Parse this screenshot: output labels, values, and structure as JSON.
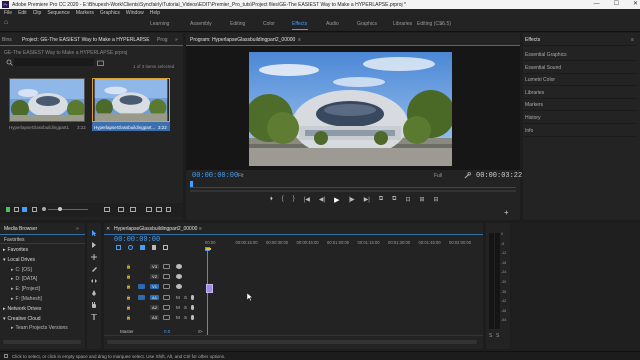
{
  "window": {
    "title": "Adobe Premiere Pro CC 2020 - E:\\Bhupesh-Work\\Clients\\Syncfairly\\Tutorial_Videos\\EDIT\\Premier_Pro_tuts\\Project files\\GE-The EASIEST Way to Make a HYPERLAPSE.prproj *",
    "app_icon": "Pr",
    "min": "—",
    "max": "☐",
    "close": "✕"
  },
  "menu": [
    "File",
    "Edit",
    "Clip",
    "Sequence",
    "Markers",
    "Graphics",
    "Window",
    "Help"
  ],
  "workspaces": {
    "home": "⌂",
    "tabs": [
      "Learning",
      "Assembly",
      "Editing",
      "Color",
      "Effects",
      "Audio",
      "Graphics",
      "Libraries",
      "Editing (CS5.5)"
    ],
    "active": "Effects",
    "more": "»"
  },
  "project_panel": {
    "tabs": [
      "Bins",
      "Project: GE-The EASIEST Way to Make a HYPERLAPSE",
      "Prog"
    ],
    "menu": "≡",
    "expand": "»",
    "path": "GE-The EASIEST Way to Make a HYPERLAPSE.prproj",
    "items_selected": "1 of 3 items selected",
    "clip1_name": "HyperlapseGlassbuildingpart1",
    "clip1_dur": "3:22",
    "clip2_name": "HyperlapseGlassbuildingpart...",
    "clip2_dur": "3:22"
  },
  "program_monitor": {
    "title": "Program: HyperlapseGlassbuildingpart2_00000",
    "menu": "≡",
    "timecode_left": "00:00:00:00",
    "fit": "Fit",
    "quality": "Full",
    "timecode_right": "00:00:03:22",
    "controls": [
      "⬧",
      "{",
      "}",
      "|◀",
      "◀|",
      "▶",
      "|▶",
      "▶|",
      "⧉",
      "⧉",
      "⊡",
      "⊞",
      "⊟"
    ],
    "add": "+"
  },
  "effects_panel": {
    "title": "Effects",
    "menu": "≡",
    "items": [
      "Essential Graphics",
      "Essential Sound",
      "Lumetri Color",
      "Libraries",
      "Markers",
      "History",
      "Info"
    ]
  },
  "media_browser": {
    "tabs": [
      "Media Browser"
    ],
    "expand": "»",
    "favorites_header": "Favorites",
    "items": [
      {
        "label": "Favorites",
        "indent": 0,
        "arrow": "▸"
      },
      {
        "label": "Local Drives",
        "indent": 0,
        "arrow": "▾"
      },
      {
        "label": "C: [OS]",
        "indent": 1,
        "arrow": "▸"
      },
      {
        "label": "D: [DATA]",
        "indent": 1,
        "arrow": "▸"
      },
      {
        "label": "E: [Project]",
        "indent": 1,
        "arrow": "▸"
      },
      {
        "label": "F: [Mahesh]",
        "indent": 1,
        "arrow": "▸"
      },
      {
        "label": "Network Drives",
        "indent": 0,
        "arrow": "▸"
      },
      {
        "label": "Creative Cloud",
        "indent": 0,
        "arrow": "▾"
      },
      {
        "label": "Team Projects Versions",
        "indent": 1,
        "arrow": "▸"
      }
    ]
  },
  "timeline": {
    "title": "HyperlapseGlassbuildingpart2_00000",
    "menu": "≡",
    "timecode": "00:00:00:00",
    "ruler": [
      "00:00",
      "00:00:15:00",
      "00:00:30:00",
      "00:00:45:00",
      "00:01:00:00",
      "00:01:15:00",
      "00:01:30:00",
      "00:01:45:00",
      "00:02:00:00"
    ],
    "tracks": [
      {
        "label": "V3",
        "type": "video"
      },
      {
        "label": "V2",
        "type": "video"
      },
      {
        "label": "V1",
        "type": "video",
        "target": true
      },
      {
        "label": "A1",
        "type": "audio",
        "target": true
      },
      {
        "label": "A2",
        "type": "audio"
      },
      {
        "label": "A3",
        "type": "audio"
      }
    ],
    "master": "Master",
    "master_val": "0.0",
    "track_btn_m": "M",
    "track_btn_s": "S"
  },
  "audio_meter": {
    "labels": [
      "0",
      "-6",
      "-12",
      "-18",
      "-24",
      "-30",
      "-36",
      "-42",
      "-48",
      "-54"
    ],
    "footer": [
      "S",
      "S"
    ]
  },
  "status": {
    "text": "Click to select, or click in empty space and drag to marquee select. Use Shift, Alt, and Ctrl for other options."
  },
  "colors": {
    "accent": "#3fa0ff",
    "clip_purple": "#a58be0",
    "panel": "#232323"
  }
}
